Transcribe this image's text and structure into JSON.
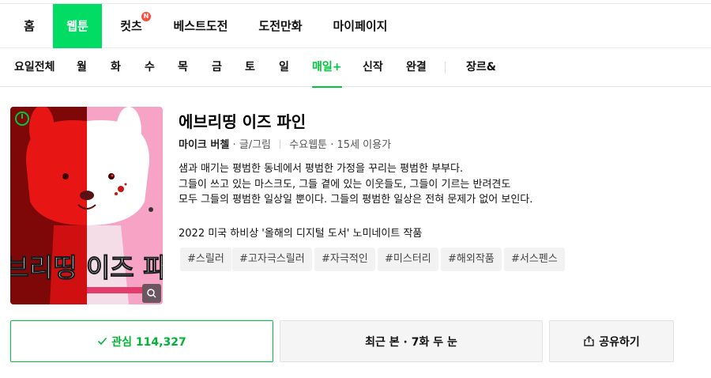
{
  "nav": {
    "items": [
      {
        "label": "홈"
      },
      {
        "label": "웹툰"
      },
      {
        "label": "컷츠",
        "badge": "N"
      },
      {
        "label": "베스트도전"
      },
      {
        "label": "도전만화"
      },
      {
        "label": "마이페이지"
      }
    ],
    "active": "웹툰"
  },
  "subnav": {
    "items": [
      {
        "label": "요일전체"
      },
      {
        "label": "월"
      },
      {
        "label": "화"
      },
      {
        "label": "수"
      },
      {
        "label": "목"
      },
      {
        "label": "금"
      },
      {
        "label": "토"
      },
      {
        "label": "일"
      },
      {
        "label": "매일+"
      },
      {
        "label": "신작"
      },
      {
        "label": "완결"
      },
      {
        "label": "장르&"
      }
    ],
    "active": "매일+"
  },
  "thumbnail": {
    "title_text": "에브리띵 이즈 파인",
    "colors": {
      "left_bg": "#b40a0a",
      "right_bg": "#f7a3c6"
    },
    "icons": {
      "zoom": "search-icon",
      "timer": "timer-icon"
    }
  },
  "comic": {
    "title": "에브리띵 이즈 파인",
    "author": "마이크 버첼",
    "author_role": "· 글/그림",
    "day_genre": "수요웹툰",
    "age": "· 15세 이용가",
    "description": [
      "샘과 매기는 평범한 동네에서 평범한 가정을 꾸리는 평범한 부부다.",
      "그들이 쓰고 있는 마스크도, 그들 곁에 있는 이웃들도, 그들이 기르는 반려견도",
      "모두 그들의 평범한 일상일 뿐이다. 그들의 평범한 일상은 전혀 문제가 없어 보인다."
    ],
    "award": "2022 미국 하비상 '올해의 디지털 도서' 노미네이트 작품",
    "tags": [
      "#스릴러",
      "#고자극스릴러",
      "#자극적인",
      "#미스터리",
      "#해외작품",
      "#서스펜스"
    ]
  },
  "actions": {
    "favorite": {
      "label": "관심 114,327",
      "icon": "check-icon"
    },
    "recent": {
      "label": "최근 본 · 7화 두 눈"
    },
    "share": {
      "label": "공유하기",
      "icon": "share-icon"
    }
  },
  "colors": {
    "brand_green": "#00dc64",
    "accent_green": "#00c73c",
    "badge_red": "#ff4b3c"
  }
}
